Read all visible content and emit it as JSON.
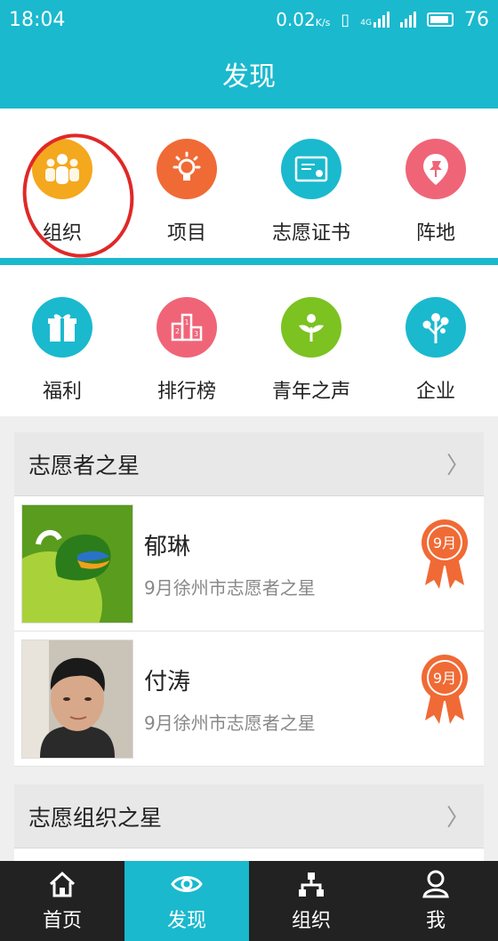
{
  "status": {
    "time": "18:04",
    "speed": "0.02",
    "speed_unit": "K/s",
    "network": "4G",
    "battery": "76"
  },
  "header": {
    "title": "发现"
  },
  "grid": {
    "row1": [
      {
        "label": "组织",
        "icon": "people-icon",
        "color": "#f4a81d"
      },
      {
        "label": "项目",
        "icon": "lightbulb-icon",
        "color": "#f06a35"
      },
      {
        "label": "志愿证书",
        "icon": "certificate-icon",
        "color": "#1ab9ce"
      },
      {
        "label": "阵地",
        "icon": "pin-icon",
        "color": "#f06478"
      }
    ],
    "row2": [
      {
        "label": "福利",
        "icon": "gift-icon",
        "color": "#1ab9ce"
      },
      {
        "label": "排行榜",
        "icon": "podium-icon",
        "color": "#f06478"
      },
      {
        "label": "青年之声",
        "icon": "sprout-icon",
        "color": "#7cc220"
      },
      {
        "label": "企业",
        "icon": "tree-icon",
        "color": "#1ab9ce"
      }
    ]
  },
  "volunteer_stars": {
    "title": "志愿者之星",
    "items": [
      {
        "name": "郁琳",
        "subtitle": "9月徐州市志愿者之星",
        "badge": "9月"
      },
      {
        "name": "付涛",
        "subtitle": "9月徐州市志愿者之星",
        "badge": "9月"
      }
    ]
  },
  "org_stars": {
    "title": "志愿组织之星"
  },
  "bottom_nav": [
    {
      "label": "首页",
      "icon": "home-icon"
    },
    {
      "label": "发现",
      "icon": "eye-icon",
      "active": true
    },
    {
      "label": "组织",
      "icon": "org-tree-icon"
    },
    {
      "label": "我",
      "icon": "user-icon"
    }
  ]
}
